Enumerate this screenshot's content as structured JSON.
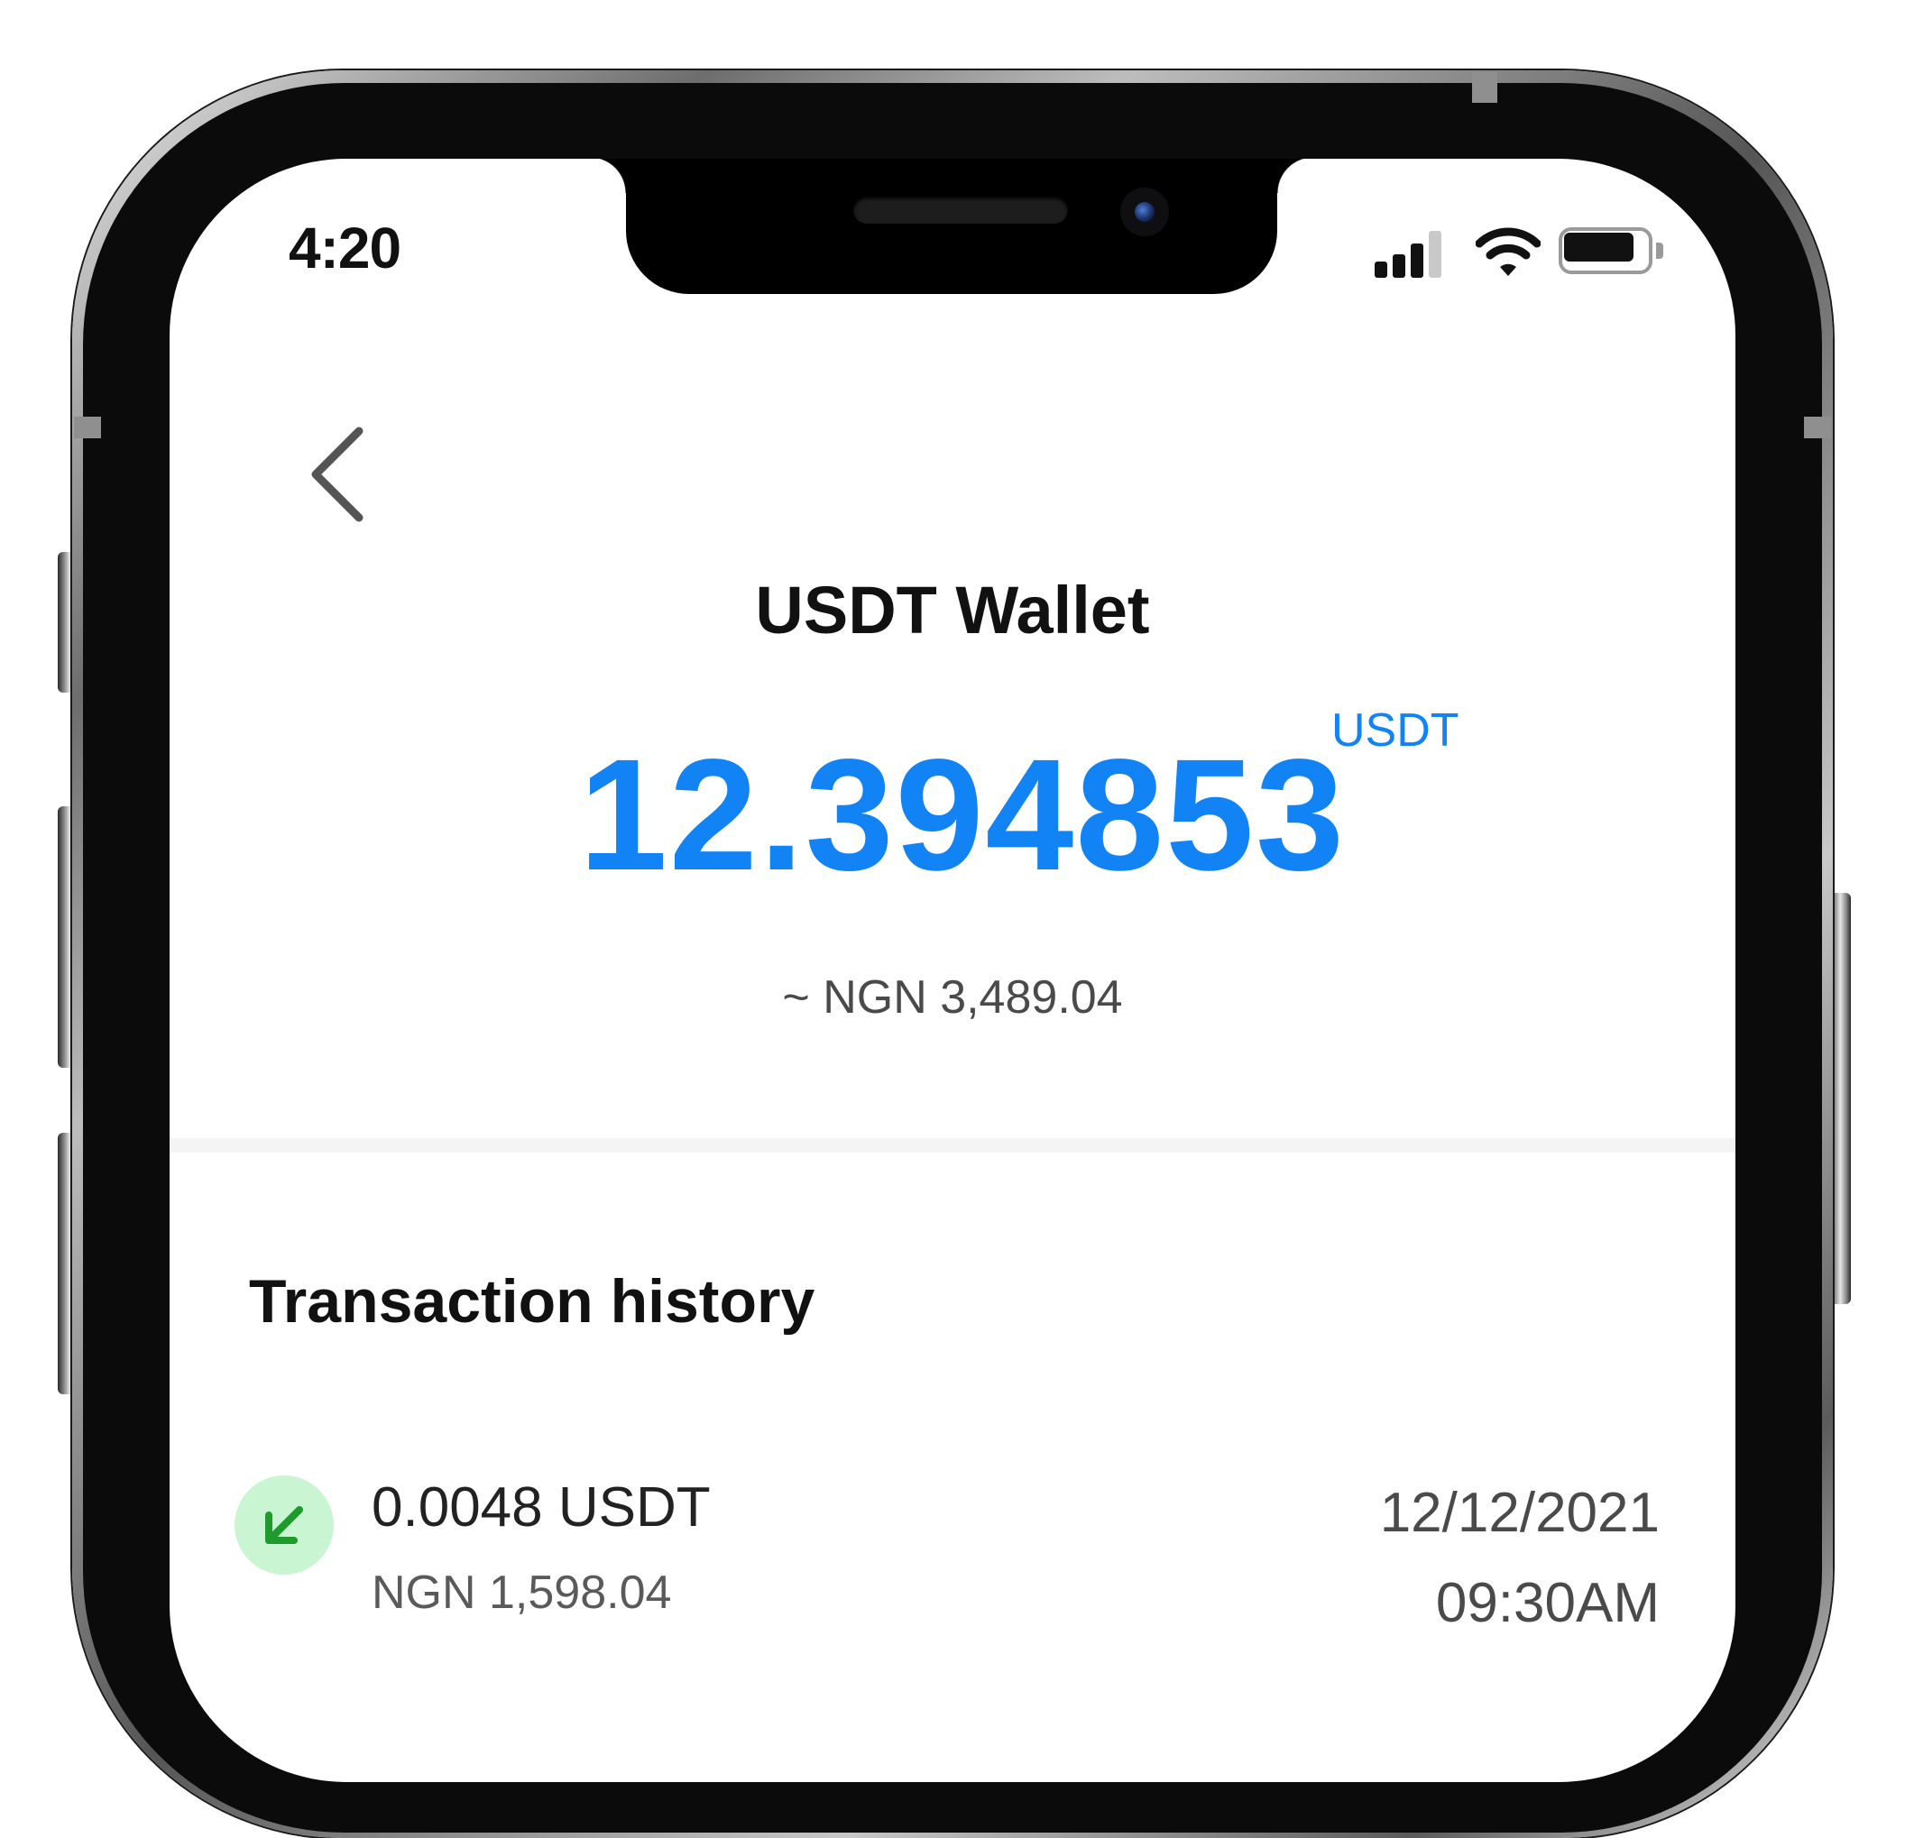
{
  "status_bar": {
    "time": "4:20"
  },
  "header": {
    "back_icon": "chevron-left-icon",
    "title": "USDT Wallet"
  },
  "balance": {
    "value": "12.394853",
    "unit": "USDT",
    "fiat_equivalent": "~ NGN 3,489.04",
    "color": "#1283f5"
  },
  "transactions": {
    "title": "Transaction history",
    "items": [
      {
        "direction_icon": "arrow-down-left-icon",
        "amount": "0.0048 USDT",
        "fiat": "NGN 1,598.04",
        "date": "12/12/2021",
        "time": "09:30AM",
        "icon_bg": "#c9f5d2",
        "icon_color": "#1f9a2d"
      }
    ]
  },
  "battery": {
    "level": 0.88
  }
}
